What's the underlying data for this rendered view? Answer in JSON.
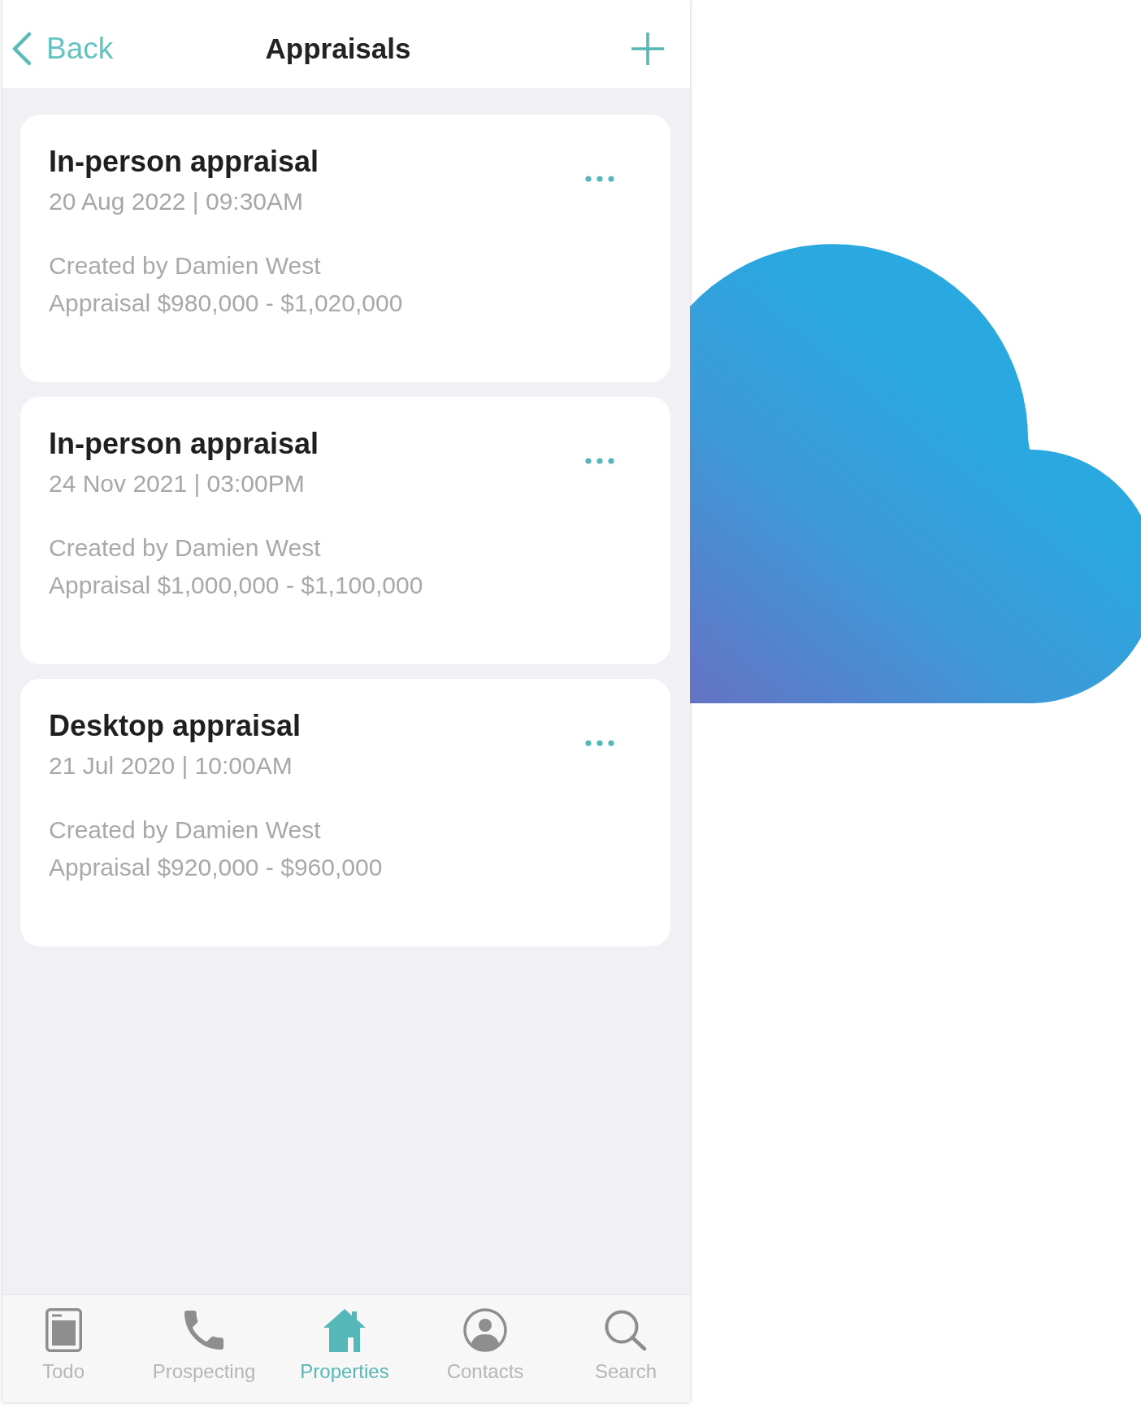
{
  "header": {
    "back": "Back",
    "title": "Appraisals"
  },
  "appraisals": [
    {
      "title": "In-person appraisal",
      "date": "20 Aug 2022 | 09:30AM",
      "created_by": "Created by Damien West",
      "range": "Appraisal $980,000 - $1,020,000"
    },
    {
      "title": "In-person appraisal",
      "date": "24 Nov 2021 | 03:00PM",
      "created_by": "Created by Damien West",
      "range": "Appraisal $1,000,000 - $1,100,000"
    },
    {
      "title": "Desktop appraisal",
      "date": "21 Jul 2020 | 10:00AM",
      "created_by": "Created by Damien West",
      "range": "Appraisal $920,000 - $960,000"
    }
  ],
  "tab_bar": {
    "tabs": [
      {
        "label": "Todo",
        "selected": false
      },
      {
        "label": "Prospecting",
        "selected": false
      },
      {
        "label": "Properties",
        "selected": true
      },
      {
        "label": "Contacts",
        "selected": false
      },
      {
        "label": "Search",
        "selected": false
      }
    ]
  }
}
